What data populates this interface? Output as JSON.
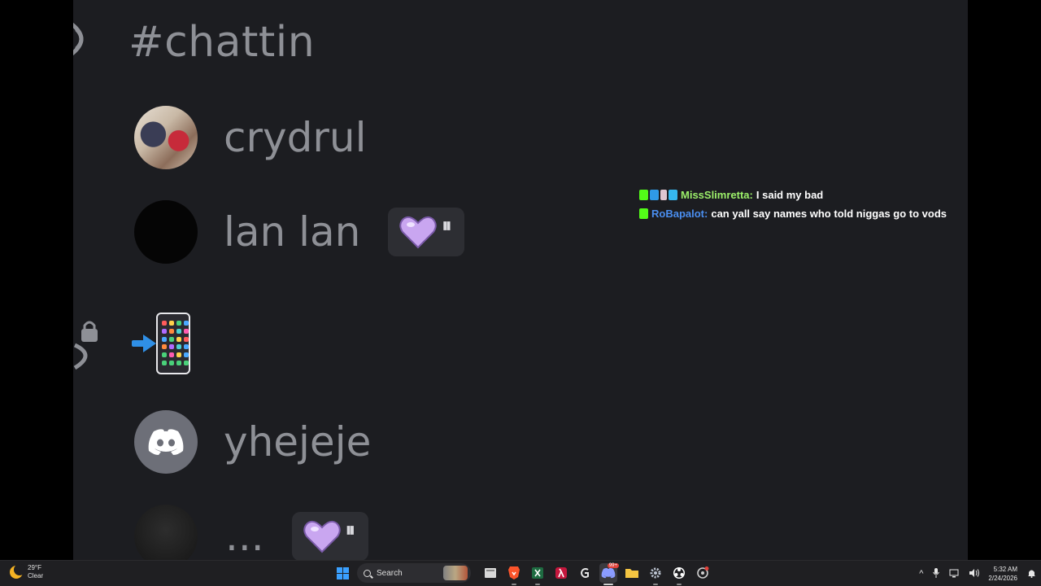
{
  "stream": {
    "channel_title": "#chattin",
    "members": [
      {
        "name": "crydrul",
        "avatar": "photo",
        "status": null
      },
      {
        "name": "lan lan",
        "avatar": "black",
        "status": "heart-pause"
      },
      {
        "name": "yhejeje",
        "avatar": "discord",
        "status": null
      },
      {
        "name": "...",
        "avatar": "dark",
        "status": "heart-pause"
      }
    ],
    "pause_symbol": "⏸"
  },
  "chat": {
    "lines": [
      {
        "user": "MissSlimretta",
        "user_color": "#9cf06a",
        "separator": ":",
        "message": "I said my bad",
        "badges": [
          "green-k",
          "blue-arrow",
          "gift",
          "blue-cube"
        ]
      },
      {
        "user": "RoBapalot",
        "user_color": "#4a8ef0",
        "separator": ":",
        "message": "can yall say names who told niggas go to vods",
        "badges": [
          "green-k"
        ]
      }
    ]
  },
  "taskbar": {
    "weather_temp": "29°F",
    "weather_desc": "Clear",
    "search_placeholder": "Search",
    "time": "5:32 AM",
    "date": "2/24/2026",
    "discord_badge": "99+"
  },
  "colors": {
    "stream_bg": "#1c1d21",
    "name_gray": "#8e9096",
    "heart": "#c9a6f0",
    "taskbar_bg": "#1f1f22"
  }
}
